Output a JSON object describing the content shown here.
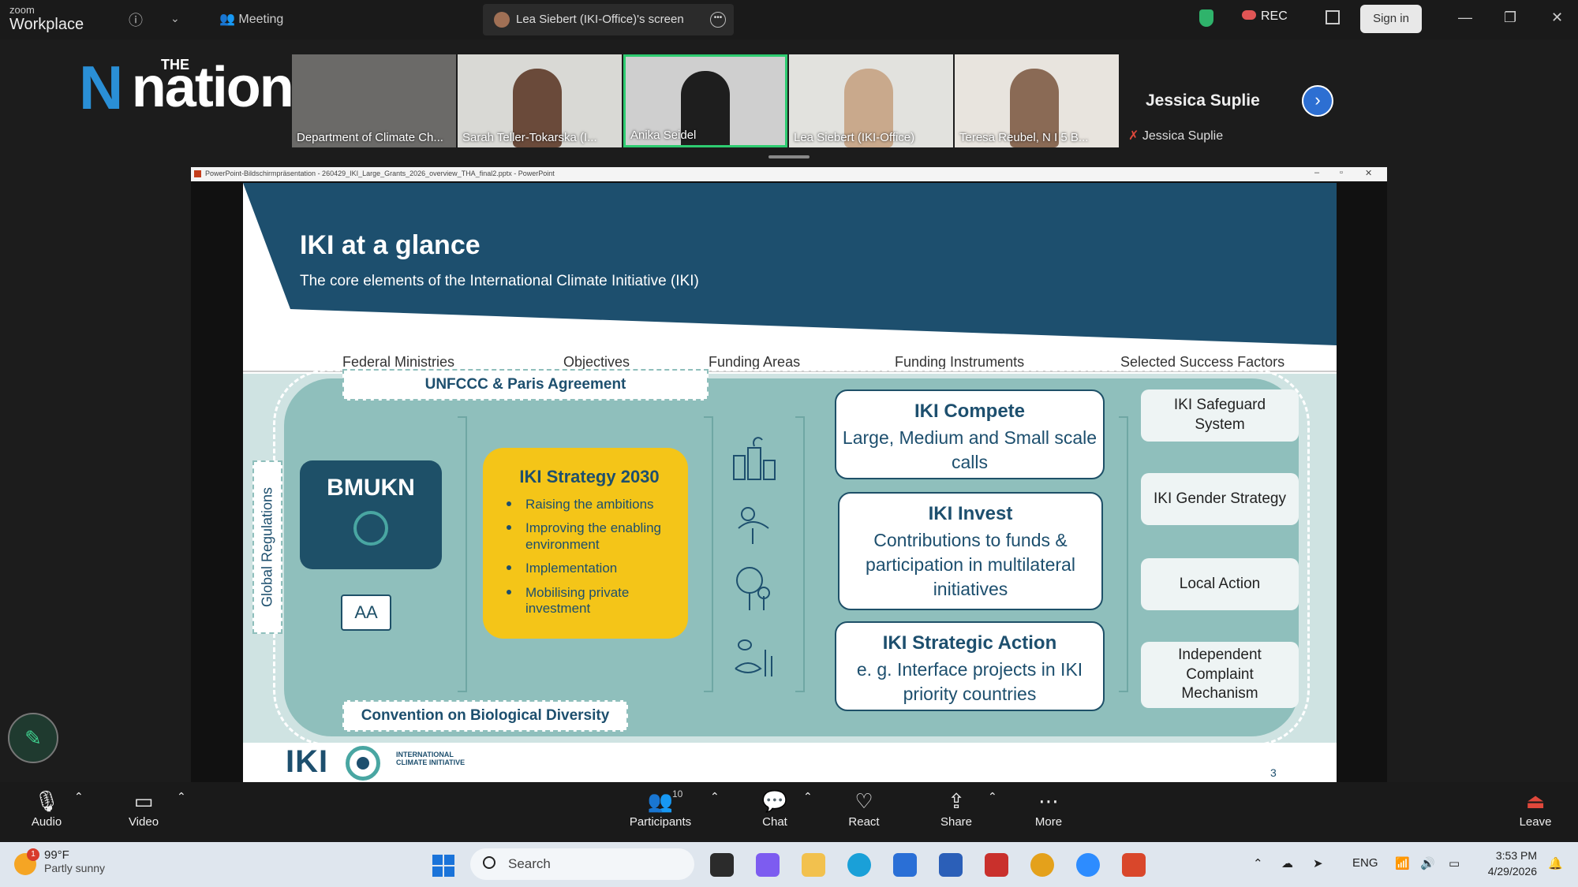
{
  "topbar": {
    "app_name_small": "zoom",
    "app_name": "Workplace",
    "meeting_label": "Meeting",
    "screen_tab_label": "Lea Siebert (IKI-Office)'s screen",
    "rec_label": "REC",
    "sign_in_label": "Sign in"
  },
  "brand": {
    "the": "THE",
    "name": "nation"
  },
  "participants_strip": {
    "tiles": [
      {
        "name": "Department of Climate Ch..."
      },
      {
        "name": "Sarah Teller-Tokarska (I..."
      },
      {
        "name": "Anika Seidel"
      },
      {
        "name": "Lea Siebert (IKI-Office)"
      },
      {
        "name": "Teresa Reubel, N I 5 B..."
      }
    ],
    "name_only_tile": {
      "title": "Jessica Suplie",
      "label": "Jessica Suplie"
    }
  },
  "ppt": {
    "window_title": "PowerPoint-Bildschirmpräsentation - 260429_IKI_Large_Grants_2026_overview_THA_final2.pptx - PowerPoint",
    "slide": {
      "title": "IKI at a glance",
      "subtitle": "The core elements of the International Climate Initiative (IKI)",
      "columns": [
        "Federal Ministries",
        "Objectives",
        "Funding Areas",
        "Funding Instruments",
        "Selected Success Factors"
      ],
      "top_box": "UNFCCC & Paris Agreement",
      "bottom_box": "Convention on Biological Diversity",
      "side_label": "Global Regulations",
      "ministry_main": "BMUKN",
      "ministry_secondary": "AA",
      "strategy": {
        "title": "IKI Strategy 2030",
        "items": [
          "Raising the ambitions",
          "Improving the enabling environment",
          "Implementation",
          "Mobilising private investment"
        ]
      },
      "instruments": [
        {
          "title": "IKI Compete",
          "desc": "Large, Medium and Small scale calls"
        },
        {
          "title": "IKI Invest",
          "desc": "Contributions to funds & participation in multilateral initiatives"
        },
        {
          "title": "IKI Strategic Action",
          "desc": "e. g. Interface projects in IKI priority countries"
        }
      ],
      "success_factors": [
        "IKI Safeguard System",
        "IKI Gender Strategy",
        "Local Action",
        "Independent Complaint Mechanism"
      ],
      "footer_logo_word": "IKI",
      "footer_logo_text": "INTERNATIONAL CLIMATE INITIATIVE",
      "page_number": "3"
    }
  },
  "controls": {
    "audio": "Audio",
    "video": "Video",
    "participants": "Participants",
    "participants_count": "10",
    "chat": "Chat",
    "react": "React",
    "share": "Share",
    "more": "More",
    "leave": "Leave"
  },
  "taskbar": {
    "weather_temp": "99°F",
    "weather_cond": "Partly sunny",
    "weather_badge": "1",
    "search_placeholder": "Search",
    "language": "ENG",
    "time": "3:53 PM",
    "date": "4/29/2026"
  },
  "colors": {
    "slide_navy": "#1d4f6e",
    "panel_teal": "#8fbfbc",
    "strategy_yellow": "#f4c518",
    "active_speaker": "#2ecc71",
    "brand_blue": "#2a8fd6"
  }
}
